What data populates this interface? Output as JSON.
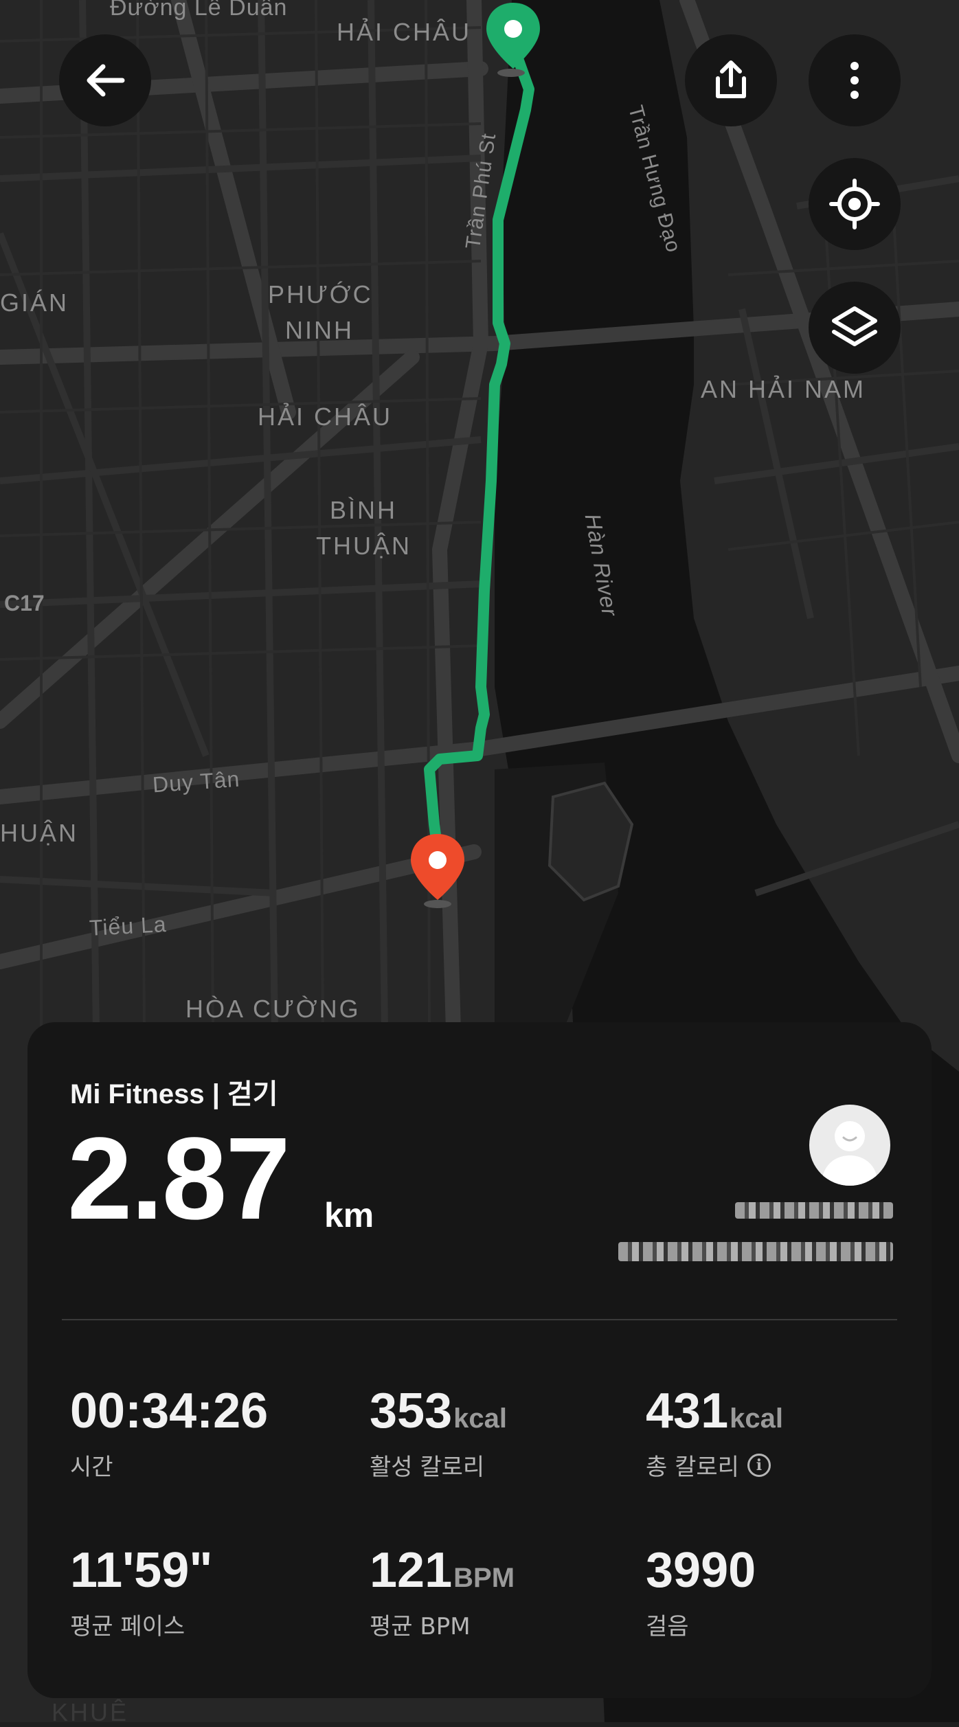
{
  "map": {
    "labels": {
      "duong_le_duan": "Đường Lê Duẩn",
      "hai_chau_top": "HẢI CHÂU",
      "tran_hung_dao": "Trần Hưng Đạo",
      "tran_phu": "Trần Phú St",
      "gian": "GIÁN",
      "phuoc_ninh_1": "PHƯỚC",
      "phuoc_ninh_2": "NINH",
      "an_hai_nam": "AN HẢI NAM",
      "hai_chau_mid": "HẢI CHÂU",
      "binh_thuan_1": "BÌNH",
      "binh_thuan_2": "THUẬN",
      "han_river": "Hàn River",
      "c17": "C17",
      "duy_tan": "Duy Tân",
      "thuan": "HUẬN",
      "tieu_la": "Tiểu La",
      "hoa_cuong": "HÒA CƯỜNG",
      "khue": "KHUÊ"
    },
    "route_color": "#1ead6b",
    "start_marker_color": "#1ead6b",
    "end_marker_color": "#ee4b2b"
  },
  "card": {
    "app_title": "Mi Fitness | 걷기",
    "distance_value": "2.87",
    "distance_unit": "km",
    "stats": [
      {
        "value": "00:34:26",
        "unit": "",
        "label": "시간"
      },
      {
        "value": "353",
        "unit": "kcal",
        "label": "활성 칼로리"
      },
      {
        "value": "431",
        "unit": "kcal",
        "label": "총 칼로리"
      },
      {
        "value": "11'59\"",
        "unit": "",
        "label": "평균 페이스"
      },
      {
        "value": "121",
        "unit": "BPM",
        "label": "평균 BPM"
      },
      {
        "value": "3990",
        "unit": "",
        "label": "걸음"
      }
    ]
  },
  "icons": {
    "back": "back-arrow-icon",
    "share": "share-icon",
    "more": "more-vertical-icon",
    "locate": "locate-icon",
    "layers": "layers-icon",
    "info": "info-icon"
  }
}
